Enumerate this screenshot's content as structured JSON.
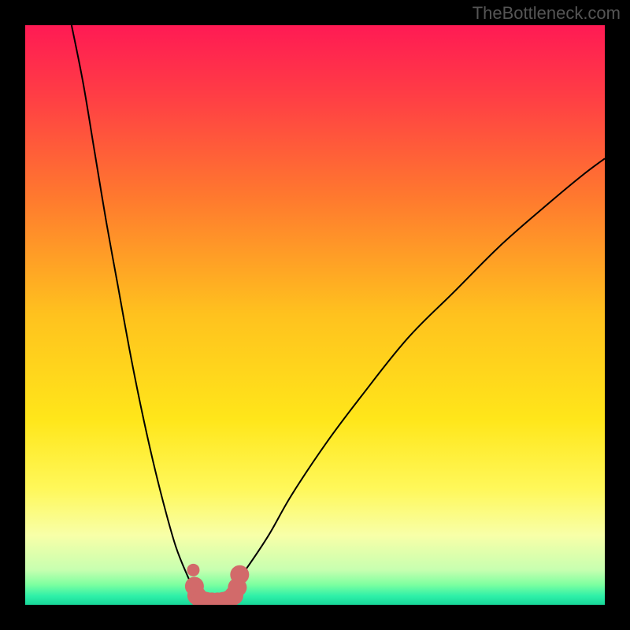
{
  "watermark": "TheBottleneck.com",
  "colors": {
    "frame_bg": "#000000",
    "watermark": "#555555",
    "gradient_stops": [
      {
        "offset": 0.0,
        "color": "#ff1a54"
      },
      {
        "offset": 0.12,
        "color": "#ff3d45"
      },
      {
        "offset": 0.3,
        "color": "#ff7a2e"
      },
      {
        "offset": 0.5,
        "color": "#ffc21e"
      },
      {
        "offset": 0.68,
        "color": "#ffe61a"
      },
      {
        "offset": 0.8,
        "color": "#fff85a"
      },
      {
        "offset": 0.88,
        "color": "#f8ffa8"
      },
      {
        "offset": 0.94,
        "color": "#c7ffb0"
      },
      {
        "offset": 0.965,
        "color": "#7effa0"
      },
      {
        "offset": 0.985,
        "color": "#2ef0a8"
      },
      {
        "offset": 1.0,
        "color": "#18d89a"
      }
    ],
    "curve": "#000000",
    "markers": "#d26a6a"
  },
  "chart_data": {
    "type": "line",
    "title": "",
    "xlabel": "",
    "ylabel": "",
    "xlim": [
      0,
      100
    ],
    "ylim": [
      0,
      100
    ],
    "note": "y is a bottleneck-style percentage; curve dips to ~0 near x≈33 then rises toward the right. Values estimated from pixels.",
    "series": [
      {
        "name": "curve-left",
        "x": [
          8,
          10,
          12,
          14,
          16,
          18,
          20,
          22,
          24,
          26,
          28,
          29,
          30,
          31,
          32
        ],
        "y": [
          100,
          90,
          78,
          66,
          55,
          44,
          34,
          25,
          17,
          10,
          5,
          3,
          2,
          1,
          0.5
        ]
      },
      {
        "name": "curve-right",
        "x": [
          33,
          35,
          38,
          42,
          46,
          52,
          58,
          66,
          74,
          82,
          90,
          96,
          100
        ],
        "y": [
          0.5,
          2,
          6,
          12,
          19,
          28,
          36,
          46,
          54,
          62,
          69,
          74,
          77
        ]
      }
    ],
    "markers": {
      "name": "highlight-min-band",
      "shape": "circle",
      "color": "#d26a6a",
      "points": [
        {
          "x": 29.0,
          "y": 6.0
        },
        {
          "x": 29.2,
          "y": 3.2
        },
        {
          "x": 29.6,
          "y": 1.6
        },
        {
          "x": 30.3,
          "y": 0.9
        },
        {
          "x": 31.2,
          "y": 0.6
        },
        {
          "x": 32.2,
          "y": 0.5
        },
        {
          "x": 33.2,
          "y": 0.5
        },
        {
          "x": 34.2,
          "y": 0.6
        },
        {
          "x": 35.2,
          "y": 0.9
        },
        {
          "x": 36.0,
          "y": 1.6
        },
        {
          "x": 36.6,
          "y": 3.0
        },
        {
          "x": 37.0,
          "y": 5.2
        }
      ]
    }
  }
}
